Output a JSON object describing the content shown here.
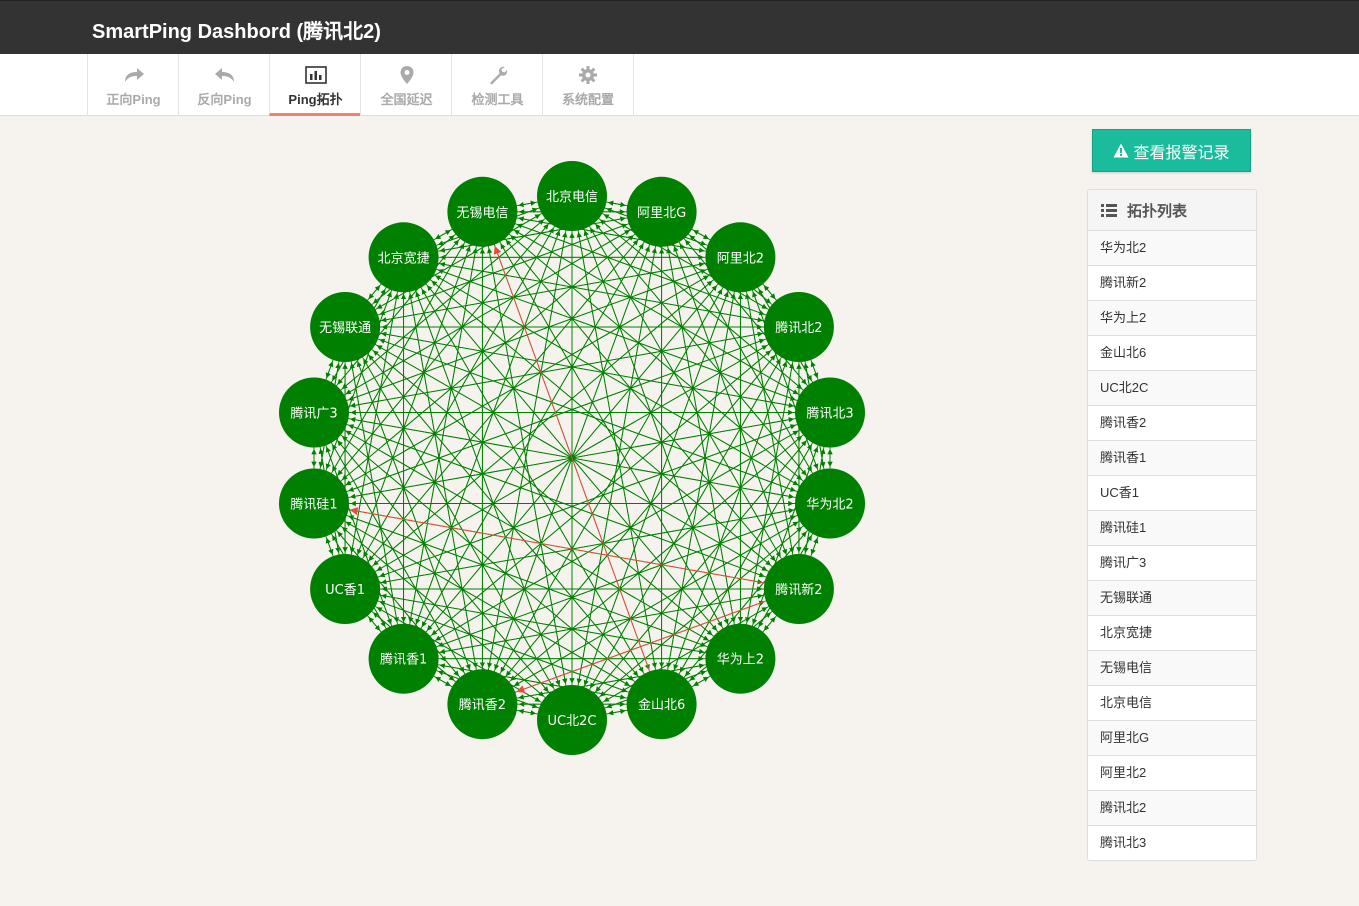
{
  "header": {
    "title": "SmartPing Dashbord (腾讯北2)"
  },
  "nav": {
    "items": [
      {
        "label": "正向Ping",
        "icon": "share-arrow-icon"
      },
      {
        "label": "反向Ping",
        "icon": "reply-arrow-icon"
      },
      {
        "label": "Ping拓扑",
        "icon": "bar-chart-icon",
        "active": true
      },
      {
        "label": "全国延迟",
        "icon": "map-marker-icon"
      },
      {
        "label": "检测工具",
        "icon": "wrench-icon"
      },
      {
        "label": "系统配置",
        "icon": "gear-icon"
      }
    ]
  },
  "alarm_button": {
    "label": "查看报警记录",
    "icon": "warning-icon"
  },
  "topology_panel": {
    "title": "拓扑列表",
    "icon": "list-icon",
    "items": [
      "华为北2",
      "腾讯新2",
      "华为上2",
      "金山北6",
      "UC北2C",
      "腾讯香2",
      "腾讯香1",
      "UC香1",
      "腾讯硅1",
      "腾讯广3",
      "无锡联通",
      "北京宽捷",
      "无锡电信",
      "北京电信",
      "阿里北G",
      "阿里北2",
      "腾讯北2",
      "腾讯北3"
    ]
  },
  "topology": {
    "nodes": [
      "北京电信",
      "阿里北G",
      "阿里北2",
      "腾讯北2",
      "腾讯北3",
      "华为北2",
      "腾讯新2",
      "华为上2",
      "金山北6",
      "UC北2C",
      "腾讯香2",
      "腾讯香1",
      "UC香1",
      "腾讯硅1",
      "腾讯广3",
      "无锡联通",
      "北京宽捷",
      "无锡电信"
    ],
    "node_color": "#008000",
    "link_color": "#008000",
    "alert_color": "#e74c3c",
    "alert_links": [
      [
        "金山北6",
        "无锡电信"
      ],
      [
        "腾讯新2",
        "腾讯硅1"
      ],
      [
        "腾讯新2",
        "腾讯香2"
      ]
    ]
  }
}
